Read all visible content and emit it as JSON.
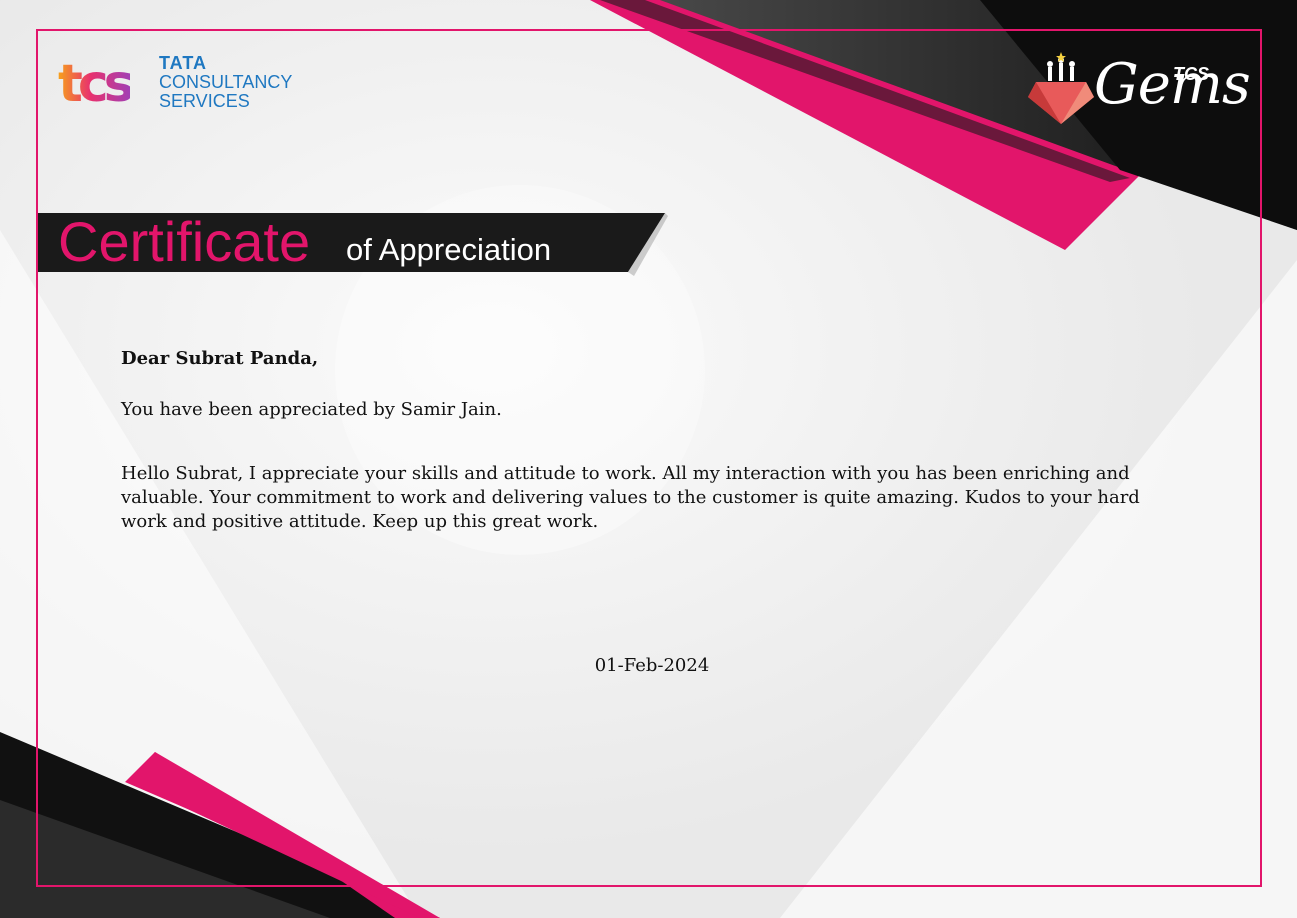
{
  "brand": {
    "tcs_mark": "tcs",
    "tcs_line1": "TATA",
    "tcs_line2": "CONSULTANCY",
    "tcs_line3": "SERVICES",
    "gems_prefix": "TCS",
    "gems_word": "Gems"
  },
  "title": {
    "main": "Certificate",
    "sub": "of Appreciation"
  },
  "body": {
    "salutation": "Dear Subrat Panda,",
    "appreciated_by": "You have been appreciated by Samir Jain.",
    "message": "Hello Subrat, I appreciate your skills and attitude to work. All my interaction with you has been enriching and valuable. Your commitment to work and delivering values to the customer is quite amazing. Kudos to your hard work and positive attitude. Keep up this great work."
  },
  "date": "01-Feb-2024",
  "colors": {
    "accent": "#e2156b",
    "dark": "#111111",
    "brand_blue": "#1f78c1"
  }
}
